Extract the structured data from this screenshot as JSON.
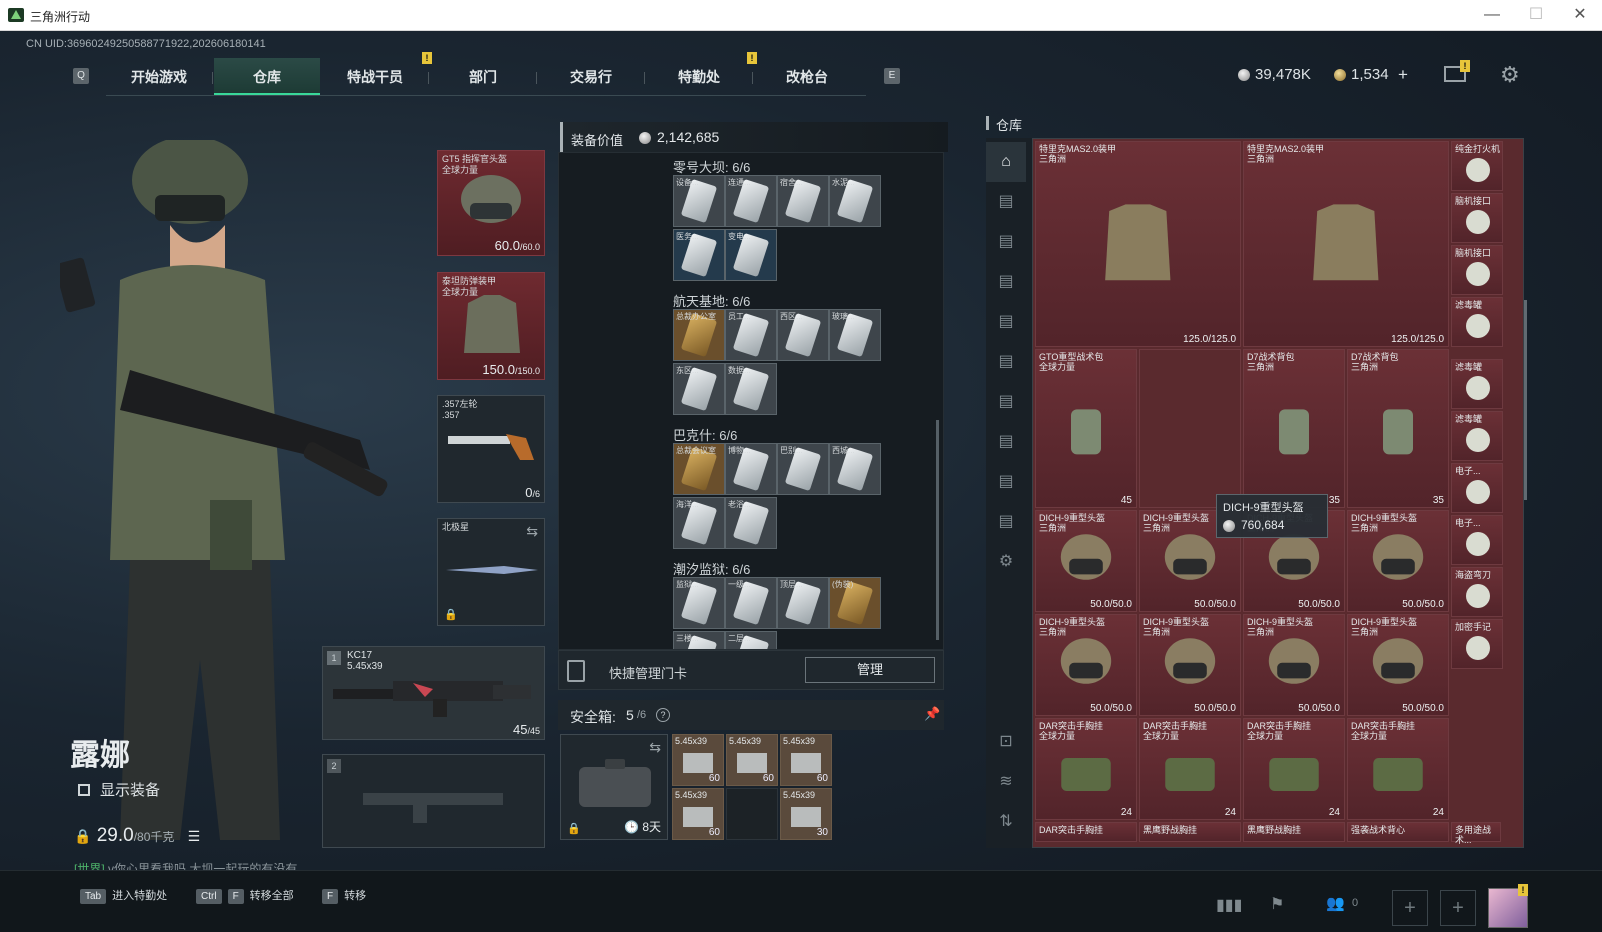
{
  "window": {
    "title": "三角洲行动",
    "controls": [
      "—",
      "☐",
      "✕"
    ]
  },
  "uid": "CN UID:36960249250588771922,202606180141",
  "nav": {
    "left_key": "Q",
    "right_key": "E",
    "tabs": [
      "开始游戏",
      "仓库",
      "特战干员",
      "部门",
      "交易行",
      "特勤处",
      "改枪台"
    ],
    "active": 1
  },
  "currency": {
    "silver": "39,478K",
    "gold": "1,534",
    "plus": "+"
  },
  "character": {
    "name": "露娜",
    "show_equip": "显示装备",
    "weight": "29.0",
    "weight_max": "/80千克"
  },
  "chat": {
    "channel": "[世界]",
    "text": "v你心里看我吗  大坝一起玩的有没有"
  },
  "equip": {
    "helmet": {
      "name": "GT5 指挥官头盔",
      "sub": "全球力量",
      "val": "60.0",
      "max": "/60.0"
    },
    "armor": {
      "name": "泰坦防弹装甲",
      "sub": "全球力量",
      "val": "150.0",
      "max": "/150.0"
    },
    "pistol": {
      "name": ".357左轮",
      "sub": ".357",
      "val": "0",
      "max": "/6"
    },
    "melee": {
      "name": "北极星"
    },
    "primary": {
      "num": "1",
      "name": "KC17",
      "caliber": "5.45x39",
      "val": "45",
      "max": "/45"
    },
    "secondary": {
      "num": "2"
    }
  },
  "mid": {
    "value_label": "装备价值",
    "value": "2,142,685",
    "groups": [
      {
        "title": "零号大坝: 6/6",
        "cards": [
          "设备...",
          "连通...",
          "宿舍...",
          "水泥...",
          "医务...",
          "变电..."
        ]
      },
      {
        "title": "航天基地: 6/6",
        "cards": [
          "总裁办公室",
          "员工...",
          "西区...",
          "玻璃...",
          "东区...",
          "数据..."
        ]
      },
      {
        "title": "巴克什: 6/6",
        "cards": [
          "总裁会议室",
          "博物...",
          "巴别...",
          "西城...",
          "海洋...",
          "老浴..."
        ]
      },
      {
        "title": "潮汐监狱: 6/6",
        "cards": [
          "监狱...",
          "一级...",
          "顶层...",
          "(伪装)",
          "三楼...",
          "二层..."
        ]
      }
    ],
    "quick": "快捷管理门卡",
    "manage": "管理",
    "safe_label": "安全箱:",
    "safe_val": "5",
    "safe_max": "/6",
    "safe_help": "?",
    "safe_time": "8天",
    "ammo": [
      {
        "cal": "5.45x39",
        "n": "60"
      },
      {
        "cal": "5.45x39",
        "n": "60"
      },
      {
        "cal": "5.45x39",
        "n": "60"
      },
      {
        "cal": "5.45x39",
        "n": "60"
      },
      {
        "cal": "5.45x39",
        "n": "30"
      }
    ]
  },
  "stash": {
    "title": "仓库",
    "tooltip": {
      "name": "DICH-9重型头盔",
      "value": "760,684"
    },
    "items": [
      {
        "name": "特里克MAS2.0装甲",
        "sub": "三角洲",
        "val": "125.0/125.0"
      },
      {
        "name": "特里克MAS2.0装甲",
        "sub": "三角洲",
        "val": "125.0/125.0"
      },
      {
        "name": "GTO重型战术包",
        "sub": "全球力量",
        "val": "45"
      },
      {
        "name": "D7战术背包",
        "sub": "三角洲",
        "val": "35"
      },
      {
        "name": "D7战术背包",
        "sub": "三角洲",
        "val": "35"
      },
      {
        "name": "DICH-9重型头盔",
        "sub": "三角洲",
        "val": "50.0/50.0"
      },
      {
        "name": "DICH-9重型头盔",
        "sub": "三角洲",
        "val": "50.0/50.0"
      },
      {
        "name": "DICH-9重型头盔",
        "sub": "三角洲",
        "val": "50.0/50.0"
      },
      {
        "name": "DICH-9重型头盔",
        "sub": "三角洲",
        "val": "50.0/50.0"
      },
      {
        "name": "DICH-9重型头盔",
        "sub": "三角洲",
        "val": "50.0/50.0"
      },
      {
        "name": "DICH-9重型头盔",
        "sub": "三角洲",
        "val": "50.0/50.0"
      },
      {
        "name": "DICH-9重型头盔",
        "sub": "三角洲",
        "val": "50.0/50.0"
      },
      {
        "name": "DICH-9重型头盔",
        "sub": "三角洲",
        "val": "50.0/50.0"
      },
      {
        "name": "DAR突击手胸挂",
        "sub": "全球力量",
        "val": "24"
      },
      {
        "name": "DAR突击手胸挂",
        "sub": "全球力量",
        "val": "24"
      },
      {
        "name": "DAR突击手胸挂",
        "sub": "全球力量",
        "val": "24"
      },
      {
        "name": "DAR突击手胸挂",
        "sub": "全球力量",
        "val": "24"
      }
    ],
    "side_items": [
      "纯金打火机",
      "脑机接口",
      "脑机接口",
      "滤毒罐",
      "滤毒罐",
      "滤毒罐",
      "电子...",
      "电子...",
      "海盗弯刀",
      "加密手记"
    ],
    "bottom_row": [
      "DAR突击手胸挂",
      "黑鹰野战胸挂",
      "黑鹰野战胸挂",
      "强袭战术背心",
      "多用途战术..."
    ]
  },
  "bottom": {
    "hints": [
      {
        "key": "Tab",
        "label": "进入特勤处"
      },
      {
        "key": "Ctrl",
        "key2": "F",
        "label": "转移全部"
      },
      {
        "key": "F",
        "label": "转移"
      }
    ],
    "friends": "0"
  }
}
